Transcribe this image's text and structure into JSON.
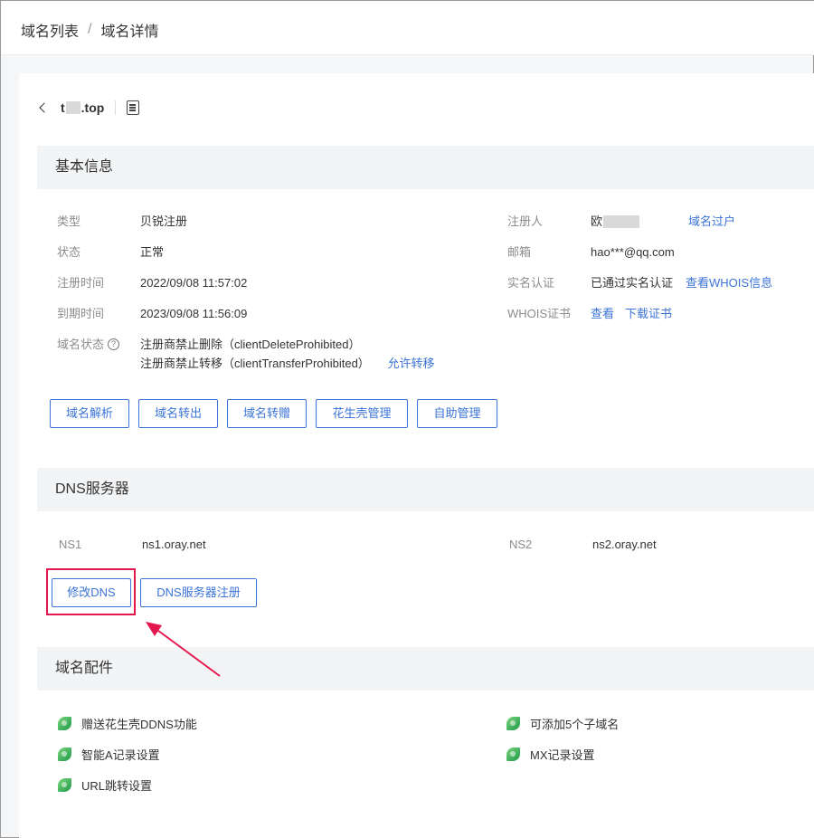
{
  "breadcrumb": {
    "list": "域名列表",
    "sep": "/",
    "current": "域名详情"
  },
  "domain": {
    "prefix": "t",
    "suffix": ".top"
  },
  "basic": {
    "title": "基本信息",
    "type_label": "类型",
    "type_value": "贝锐注册",
    "status_label": "状态",
    "status_value": "正常",
    "reg_time_label": "注册时间",
    "reg_time_value": "2022/09/08 11:57:02",
    "expire_label": "到期时间",
    "expire_value": "2023/09/08 11:56:09",
    "domain_status_label": "域名状态",
    "domain_status_1": "注册商禁止删除（clientDeleteProhibited）",
    "domain_status_2": "注册商禁止转移（clientTransferProhibited）",
    "allow_transfer": "允许转移",
    "registrant_label": "注册人",
    "registrant_value": "欧",
    "transfer_owner": "域名过户",
    "email_label": "邮箱",
    "email_value": "hao***@qq.com",
    "realname_label": "实名认证",
    "realname_value": "已通过实名认证",
    "whois_link": "查看WHOIS信息",
    "cert_label": "WHOIS证书",
    "cert_view": "查看",
    "cert_download": "下载证书",
    "buttons": [
      "域名解析",
      "域名转出",
      "域名转赠",
      "花生壳管理",
      "自助管理"
    ]
  },
  "dns": {
    "title": "DNS服务器",
    "ns1_label": "NS1",
    "ns1_value": "ns1.oray.net",
    "ns2_label": "NS2",
    "ns2_value": "ns2.oray.net",
    "modify_btn": "修改DNS",
    "register_btn": "DNS服务器注册"
  },
  "addons": {
    "title": "域名配件",
    "items": [
      "赠送花生壳DDNS功能",
      "可添加5个子域名",
      "智能A记录设置",
      "MX记录设置",
      "URL跳转设置"
    ]
  },
  "colors": {
    "link": "#3b73d6",
    "highlight": "#e3174d",
    "leaf": "#1f9a4a"
  }
}
